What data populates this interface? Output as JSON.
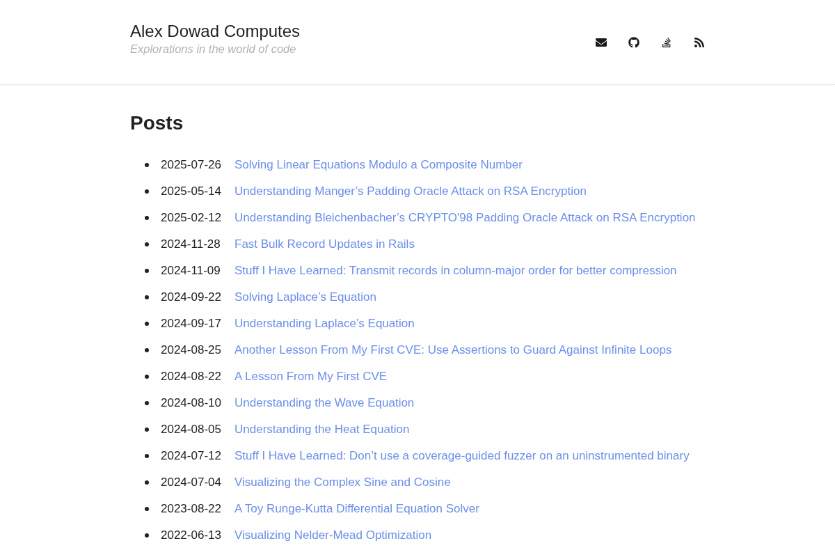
{
  "site": {
    "title": "Alex Dowad Computes",
    "tagline": "Explorations in the world of code"
  },
  "icon_links": [
    {
      "kind": "envelope"
    },
    {
      "kind": "cat"
    },
    {
      "kind": "stack"
    },
    {
      "kind": "feed"
    }
  ],
  "posts": {
    "heading": "Posts",
    "items": [
      {
        "date": "2025-07-26",
        "title": "Solving Linear Equations Modulo a Composite Number"
      },
      {
        "date": "2025-05-14",
        "title": "Understanding Manger’s Padding Oracle Attack on RSA Encryption"
      },
      {
        "date": "2025-02-12",
        "title": "Understanding Bleichenbacher’s CRYPTO'98 Padding Oracle Attack on RSA Encryption"
      },
      {
        "date": "2024-11-28",
        "title": "Fast Bulk Record Updates in Rails"
      },
      {
        "date": "2024-11-09",
        "title": "Stuff I Have Learned: Transmit records in column-major order for better compression"
      },
      {
        "date": "2024-09-22",
        "title": "Solving Laplace’s Equation"
      },
      {
        "date": "2024-09-17",
        "title": "Understanding Laplace’s Equation"
      },
      {
        "date": "2024-08-25",
        "title": "Another Lesson From My First CVE: Use Assertions to Guard Against Infinite Loops"
      },
      {
        "date": "2024-08-22",
        "title": "A Lesson From My First CVE"
      },
      {
        "date": "2024-08-10",
        "title": "Understanding the Wave Equation"
      },
      {
        "date": "2024-08-05",
        "title": "Understanding the Heat Equation"
      },
      {
        "date": "2024-07-12",
        "title": "Stuff I Have Learned: Don’t use a coverage-guided fuzzer on an uninstrumented binary"
      },
      {
        "date": "2024-07-04",
        "title": "Visualizing the Complex Sine and Cosine"
      },
      {
        "date": "2023-08-22",
        "title": "A Toy Runge-Kutta Differential Equation Solver"
      },
      {
        "date": "2022-06-13",
        "title": "Visualizing Nelder-Mead Optimization"
      }
    ]
  }
}
